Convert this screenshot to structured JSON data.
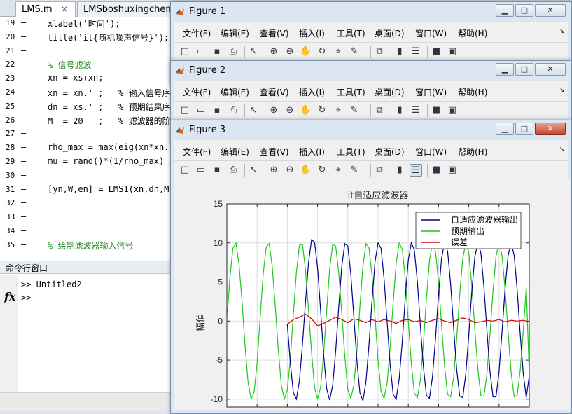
{
  "editor": {
    "tabs": [
      {
        "label": "LMS.m",
        "close": "×"
      },
      {
        "label": "LMSboshuxingchen",
        "close": ""
      }
    ],
    "lines": [
      {
        "num": "19",
        "code": "xlabel('时间');",
        "kind": "code"
      },
      {
        "num": "20",
        "code": "title('it{随机噪声信号}');",
        "kind": "code"
      },
      {
        "num": "21",
        "code": "",
        "kind": "code"
      },
      {
        "num": "22",
        "code": "% 信号滤波",
        "kind": "cmt"
      },
      {
        "num": "23",
        "code": "xn = xs+xn;",
        "kind": "code"
      },
      {
        "num": "24",
        "code": "xn = xn.' ;   % 输入信号序",
        "kind": "mix"
      },
      {
        "num": "25",
        "code": "dn = xs.' ;   % 预期结果序",
        "kind": "mix"
      },
      {
        "num": "26",
        "code": "M  = 20   ;   % 滤波器的阶",
        "kind": "mix"
      },
      {
        "num": "27",
        "code": "",
        "kind": "code"
      },
      {
        "num": "28",
        "code": "rho_max = max(eig(xn*xn.'",
        "kind": "code"
      },
      {
        "num": "29",
        "code": "mu = rand()*(1/rho_max)",
        "kind": "code"
      },
      {
        "num": "30",
        "code": "",
        "kind": "code"
      },
      {
        "num": "31",
        "code": "[yn,W,en] = LMS1(xn,dn,M,",
        "kind": "code"
      },
      {
        "num": "32",
        "code": "",
        "kind": "code"
      },
      {
        "num": "33",
        "code": "",
        "kind": "code"
      },
      {
        "num": "34",
        "code": "",
        "kind": "code"
      },
      {
        "num": "35",
        "code": "% 绘制滤波器输入信号",
        "kind": "cmt"
      }
    ],
    "dash": "–"
  },
  "command_window": {
    "title": "命令行窗口",
    "prompt_line_1": ">> Untitled2",
    "prompt_line_2": ">>",
    "fx": "fx"
  },
  "figures": [
    {
      "title": "Figure 1"
    },
    {
      "title": "Figure 2"
    },
    {
      "title": "Figure 3"
    }
  ],
  "window_buttons": {
    "minimize": "▁",
    "maximize": "□",
    "close": "✕"
  },
  "menus": [
    "文件(F)",
    "编辑(E)",
    "查看(V)",
    "插入(I)",
    "工具(T)",
    "桌面(D)",
    "窗口(W)",
    "帮助(H)"
  ],
  "menu_overflow": "↘",
  "toolbar_icons": [
    {
      "name": "new-figure-icon",
      "glyph": "□"
    },
    {
      "name": "open-file-icon",
      "glyph": "▭"
    },
    {
      "name": "save-icon",
      "glyph": "▪"
    },
    {
      "name": "print-icon",
      "glyph": "⎙"
    },
    {
      "name": "sep",
      "glyph": ""
    },
    {
      "name": "pointer-icon",
      "glyph": "↖"
    },
    {
      "name": "sep",
      "glyph": ""
    },
    {
      "name": "zoom-in-icon",
      "glyph": "⊕"
    },
    {
      "name": "zoom-out-icon",
      "glyph": "⊖"
    },
    {
      "name": "pan-hand-icon",
      "glyph": "✋"
    },
    {
      "name": "rotate-3d-icon",
      "glyph": "↻"
    },
    {
      "name": "data-cursor-icon",
      "glyph": "⌖"
    },
    {
      "name": "brush-icon",
      "glyph": "✎"
    },
    {
      "name": "sep",
      "glyph": ""
    },
    {
      "name": "link-plot-icon",
      "glyph": "⧉"
    },
    {
      "name": "sep",
      "glyph": ""
    },
    {
      "name": "colorbar-icon",
      "glyph": "▮"
    },
    {
      "name": "legend-icon",
      "glyph": "☰"
    },
    {
      "name": "sep",
      "glyph": ""
    },
    {
      "name": "hide-plot-tools-icon",
      "glyph": "■"
    },
    {
      "name": "show-plot-tools-icon",
      "glyph": "▣"
    }
  ],
  "chart_data": {
    "type": "line",
    "title": "it自适应滤波器",
    "xlabel": "",
    "ylabel": "幅值",
    "ylim": [
      -11,
      15
    ],
    "yticks": [
      15,
      10,
      5,
      0,
      -5,
      -10
    ],
    "xlim": [
      0,
      100
    ],
    "grid": true,
    "legend_placement": "top-right",
    "series": [
      {
        "name": "自适应滤波器输出",
        "color": "#00008b",
        "x": [
          20,
          21,
          22,
          23,
          24,
          25,
          26,
          27,
          28,
          29,
          30,
          31,
          32,
          33,
          34,
          35,
          36,
          37,
          38,
          39,
          40,
          41,
          42,
          43,
          44,
          45,
          46,
          47,
          48,
          49,
          50,
          51,
          52,
          53,
          54,
          55,
          56,
          57,
          58,
          59,
          60,
          61,
          62,
          63,
          64,
          65,
          66,
          67,
          68,
          69,
          70,
          71,
          72,
          73,
          74,
          75,
          76,
          77,
          78,
          79,
          80,
          81,
          82,
          83,
          84,
          85,
          86,
          87,
          88,
          89,
          90,
          91,
          92,
          93,
          94,
          95,
          96,
          97,
          98,
          99,
          100
        ],
        "y": [
          -0.4,
          -5.4,
          -9.2,
          -10.0,
          -7.6,
          -3.0,
          2.4,
          7.4,
          10.4,
          10.1,
          6.8,
          1.4,
          -4.3,
          -8.7,
          -10.1,
          -8.2,
          -3.8,
          1.8,
          7.0,
          9.9,
          9.6,
          6.0,
          0.5,
          -5.1,
          -9.2,
          -10.2,
          -7.8,
          -3.1,
          2.6,
          7.6,
          10.0,
          9.3,
          5.4,
          -0.2,
          -5.6,
          -9.4,
          -10.0,
          -7.4,
          -2.6,
          3.0,
          7.8,
          10.0,
          9.1,
          5.0,
          -0.6,
          -5.9,
          -9.5,
          -9.9,
          -7.1,
          -2.2,
          3.4,
          8.0,
          10.0,
          8.9,
          4.7,
          -0.9,
          -6.2,
          -9.6,
          -9.8,
          -6.8,
          -1.8,
          3.8,
          8.2,
          10.0,
          8.7,
          4.4,
          -1.2,
          -6.4,
          -9.7,
          -9.7,
          -6.5,
          -1.4,
          4.1,
          8.4,
          10.0,
          8.4,
          4.0,
          -1.6,
          -6.7,
          -9.8,
          -7.0
        ]
      },
      {
        "name": "预期输出",
        "color": "#1ec81e",
        "x": [
          0,
          1,
          2,
          3,
          4,
          5,
          6,
          7,
          8,
          9,
          10,
          11,
          12,
          13,
          14,
          15,
          16,
          17,
          18,
          19,
          20,
          21,
          22,
          23,
          24,
          25,
          26,
          27,
          28,
          29,
          30,
          31,
          32,
          33,
          34,
          35,
          36,
          37,
          38,
          39,
          40,
          41,
          42,
          43,
          44,
          45,
          46,
          47,
          48,
          49,
          50,
          51,
          52,
          53,
          54,
          55,
          56,
          57,
          58,
          59,
          60,
          61,
          62,
          63,
          64,
          65,
          66,
          67,
          68,
          69,
          70,
          71,
          72,
          73,
          74,
          75,
          76,
          77,
          78,
          79,
          80,
          81,
          82,
          83,
          84,
          85,
          86,
          87,
          88,
          89,
          90,
          91,
          92,
          93,
          94,
          95,
          96,
          97,
          98,
          99,
          100
        ],
        "y": [
          0.0,
          5.5,
          9.3,
          10.0,
          7.3,
          2.6,
          -3.0,
          -7.8,
          -10.0,
          -9.1,
          -5.4,
          0.3,
          5.9,
          9.5,
          9.9,
          7.0,
          2.0,
          -3.6,
          -8.2,
          -10.0,
          -8.8,
          -4.8,
          0.9,
          6.3,
          9.7,
          9.8,
          6.6,
          1.5,
          -4.0,
          -8.5,
          -10.0,
          -8.5,
          -4.3,
          1.4,
          6.7,
          9.8,
          9.6,
          6.2,
          1.0,
          -4.5,
          -8.8,
          -9.9,
          -8.2,
          -3.8,
          1.9,
          7.0,
          9.9,
          9.4,
          5.8,
          0.5,
          -5.0,
          -9.0,
          -9.9,
          -7.9,
          -3.3,
          2.4,
          7.4,
          10.0,
          9.2,
          5.4,
          0.0,
          -5.4,
          -9.2,
          -9.8,
          -7.5,
          -2.8,
          2.9,
          7.7,
          10.0,
          8.9,
          5.0,
          -0.5,
          -5.8,
          -9.4,
          -9.7,
          -7.2,
          -2.3,
          3.4,
          8.0,
          10.0,
          8.7,
          4.5,
          -1.0,
          -6.2,
          -9.6,
          -9.6,
          -6.8,
          -1.8,
          3.8,
          8.3,
          10.0,
          8.4,
          4.1,
          -1.5,
          -6.6,
          -9.7,
          -9.5,
          -6.4,
          -1.3,
          4.3,
          -7.0
        ]
      },
      {
        "name": "误差",
        "color": "#d00000",
        "x": [
          20,
          22,
          24,
          26,
          28,
          30,
          32,
          34,
          36,
          38,
          40,
          42,
          44,
          46,
          48,
          50,
          52,
          54,
          56,
          58,
          60,
          62,
          64,
          66,
          68,
          70,
          72,
          74,
          76,
          78,
          80,
          82,
          84,
          86,
          88,
          90,
          92,
          94,
          96,
          98,
          100
        ],
        "y": [
          -0.4,
          0.2,
          0.5,
          0.9,
          0.3,
          -0.6,
          -0.3,
          0.1,
          0.5,
          0.2,
          -0.2,
          0.3,
          0.1,
          -0.2,
          0.2,
          -0.1,
          0.2,
          0.0,
          -0.3,
          0.1,
          0.2,
          -0.1,
          0.1,
          -0.2,
          0.1,
          0.3,
          0.0,
          -0.2,
          0.1,
          0.4,
          0.2,
          -0.2,
          -0.1,
          0.1,
          0.0,
          0.2,
          -0.1,
          0.1,
          0.0,
          0.1,
          -0.1
        ]
      }
    ]
  }
}
